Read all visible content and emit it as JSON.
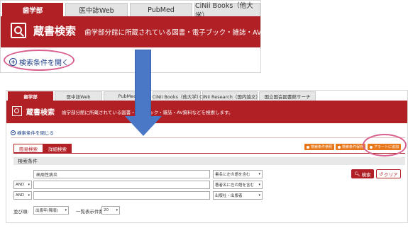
{
  "top": {
    "tabs": [
      "歯学部",
      "医中誌Web",
      "PubMed",
      "CiNii Books（他大学）"
    ],
    "title": "蔵書検索",
    "description": "歯学部分館に所蔵されている図書・電子ブック・雑誌・AV資料などを検",
    "open_conditions": "検索条件を開く"
  },
  "bottom": {
    "tabs": [
      "歯学部",
      "医中誌Web",
      "PubMed",
      "CiNii Books（他大学）",
      "CiNii Research（国内論文）",
      "国立国会図書館サーチ"
    ],
    "title": "蔵書検索",
    "description": "歯学部分館に所蔵されている図書・電子ブック・雑誌・AV資料などを検索します。",
    "close_conditions": "検索条件を閉じる",
    "mode_simple": "簡易検索",
    "mode_detail": "詳細検索",
    "orange_buttons": [
      "検索条件参照",
      "検索条件保存",
      "アラートに追加"
    ],
    "conditions_header": "検索条件",
    "keyword_value": "歯周性病炎",
    "rows": [
      {
        "op": "",
        "field": "書名に左の語を含む"
      },
      {
        "op": "AND",
        "field": "著者名に左の語を含む"
      },
      {
        "op": "AND",
        "field": "出版社・出版者"
      }
    ],
    "search_button": "検索",
    "clear_button": "クリア",
    "sort_label": "並び順:",
    "sort_value": "出版年(降順)",
    "count_label": "一覧表示件数:",
    "count_value": "20"
  },
  "colors": {
    "brand_red": "#b02025",
    "accent_orange": "#e8771a",
    "link_blue": "#1f3f8a",
    "highlight_pink": "#d9608e",
    "arrow_blue": "#4a77c6"
  }
}
